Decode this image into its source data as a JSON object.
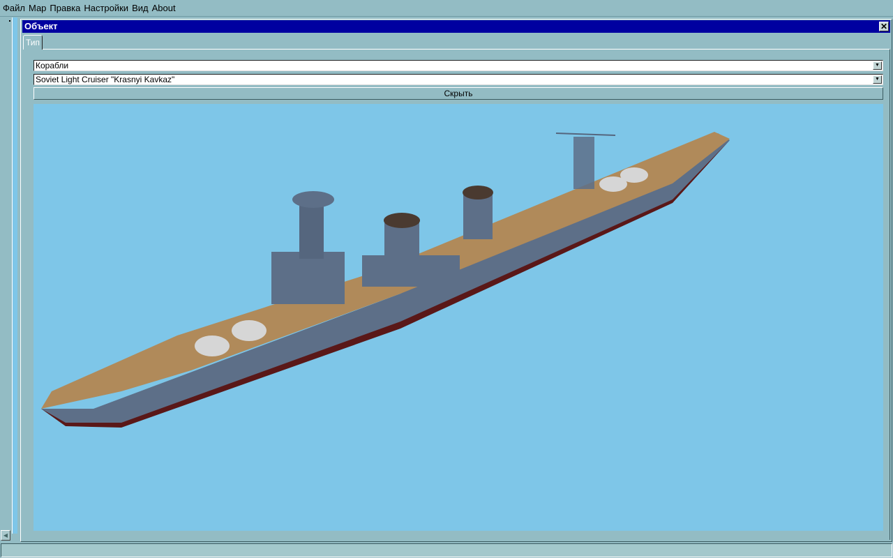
{
  "menu": [
    "Файл",
    "Мар",
    "Правка",
    "Настройки",
    "Вид",
    "About"
  ],
  "window": {
    "title": "Объект",
    "close_icon": "x-icon"
  },
  "tab": {
    "label": "Тип"
  },
  "category_select": {
    "value": "Корабли"
  },
  "object_select": {
    "value": "Soviet Light Cruiser \"Krasnyi Kavkaz\""
  },
  "hide_button": {
    "label": "Скрыть"
  },
  "viewport": {
    "background": "#7ec6e8",
    "model": "ship-3d-model"
  },
  "colors": {
    "titlebar": "#0000a0",
    "chrome": "#93bcc4",
    "deck": "#b08a5a",
    "hull": "#5d6f88"
  }
}
